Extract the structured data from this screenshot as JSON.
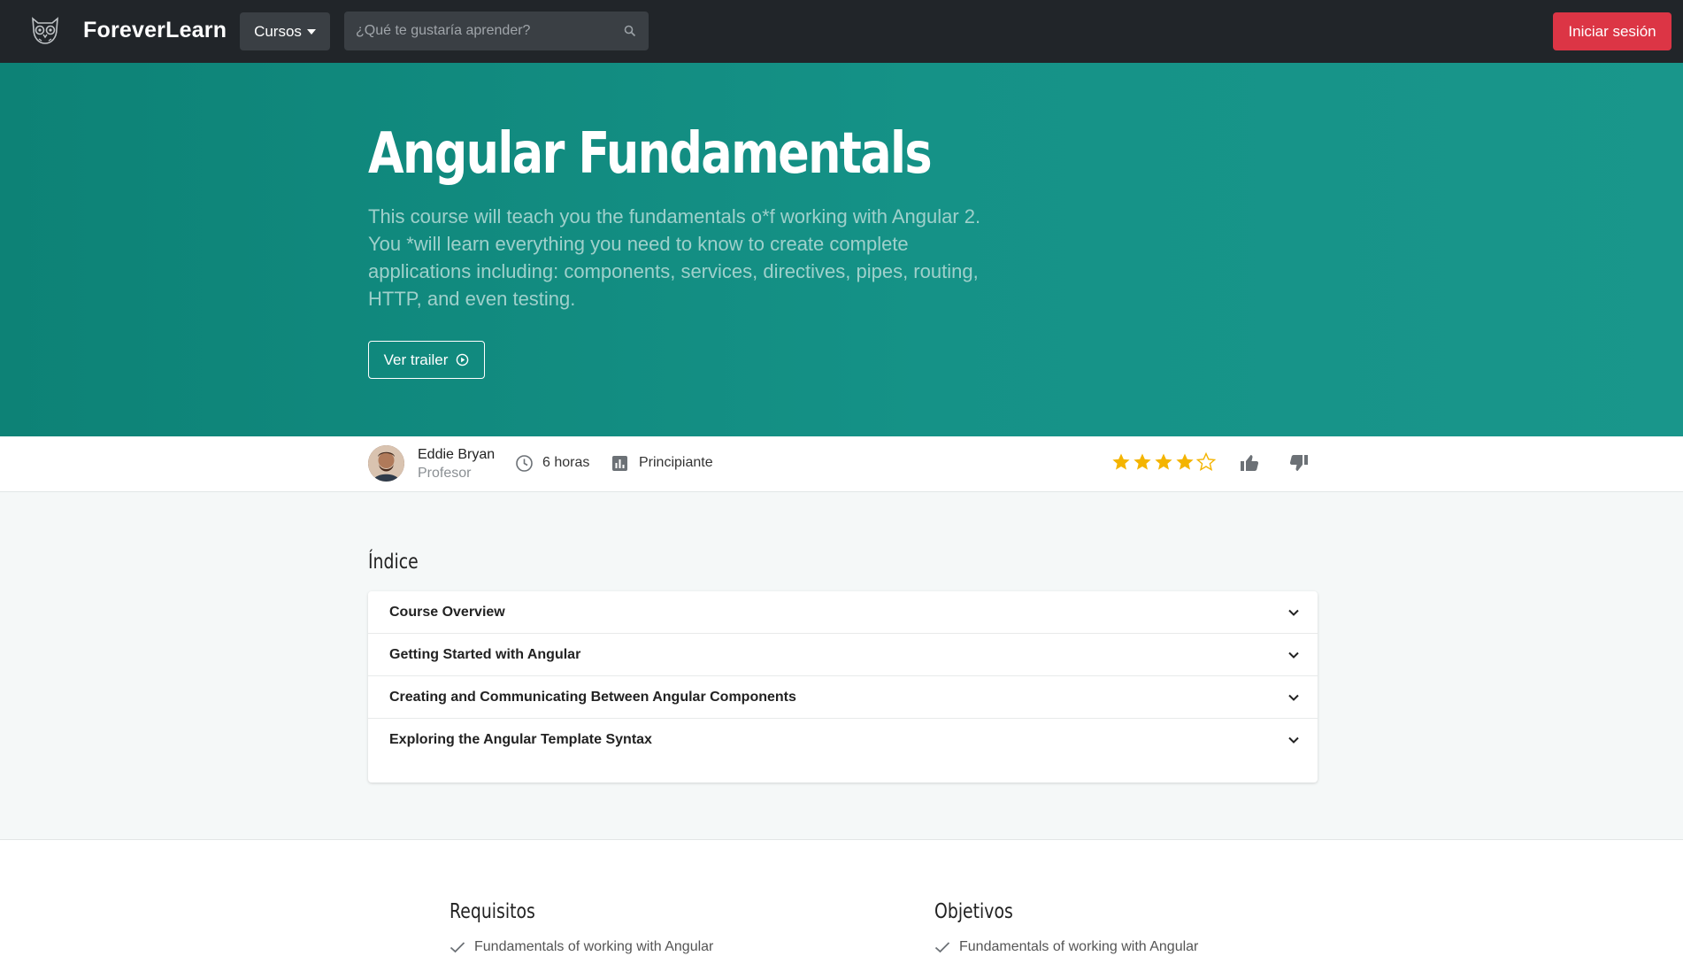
{
  "navbar": {
    "brand": "ForeverLearn",
    "courses_label": "Cursos",
    "search_placeholder": "¿Qué te gustaría aprender?",
    "login_label": "Iniciar sesión"
  },
  "hero": {
    "title": "Angular Fundamentals",
    "description": "This course will teach you the fundamentals o*f working with Angular 2. You *will learn everything you need to know to create complete applications including: components, services, directives, pipes, routing, HTTP, and even testing.",
    "trailer_label": "Ver trailer"
  },
  "info": {
    "teacher_name": "Eddie Bryan",
    "teacher_role": "Profesor",
    "hours": "6 horas",
    "level": "Principiante",
    "rating": 4,
    "rating_max": 5
  },
  "index": {
    "title": "Índice",
    "items": [
      "Course Overview",
      "Getting Started with Angular",
      "Creating and Communicating Between Angular Components",
      "Exploring the Angular Template Syntax"
    ]
  },
  "requirements": {
    "title": "Requisitos",
    "items": [
      "Fundamentals of working with Angular"
    ]
  },
  "objectives": {
    "title": "Objetivos",
    "items": [
      "Fundamentals of working with Angular"
    ]
  },
  "colors": {
    "navbar": "#212529",
    "hero": "#13897e",
    "accent_red": "#dc3545",
    "star": "#f4b400"
  }
}
